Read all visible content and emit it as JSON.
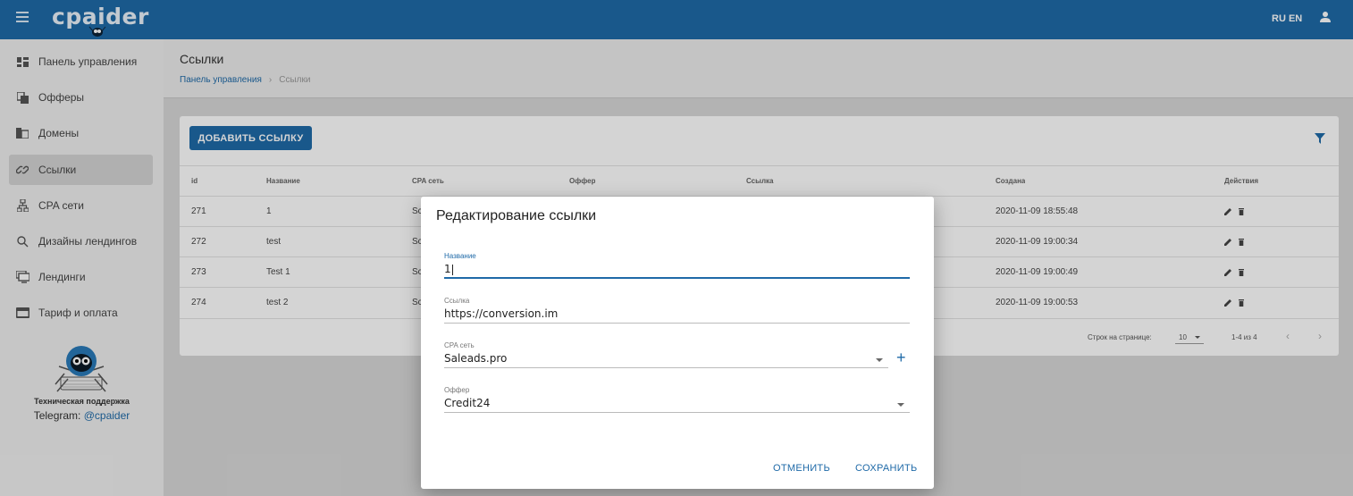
{
  "header": {
    "logo": "cpaider",
    "lang": "RU EN",
    "icons": {
      "menu": "menu-icon",
      "user": "user-icon"
    },
    "accent_color": "#1f6aa8"
  },
  "sidebar": {
    "items": [
      {
        "label": "Панель управления",
        "icon": "dashboard-icon"
      },
      {
        "label": "Офферы",
        "icon": "copy-icon"
      },
      {
        "label": "Домены",
        "icon": "domain-icon"
      },
      {
        "label": "Ссылки",
        "icon": "link-icon",
        "active": true
      },
      {
        "label": "CPA сети",
        "icon": "network-icon"
      },
      {
        "label": "Дизайны лендингов",
        "icon": "search-icon"
      },
      {
        "label": "Лендинги",
        "icon": "monitor-icon"
      },
      {
        "label": "Тариф и оплата",
        "icon": "payment-icon"
      }
    ],
    "support_title": "Техническая поддержка",
    "support_tg_prefix": "Telegram: ",
    "support_tg_handle": "@cpaider"
  },
  "page": {
    "title": "Ссылки",
    "breadcrumb_home": "Панель управления",
    "breadcrumb_sep": "›",
    "breadcrumb_current": "Ссылки"
  },
  "table": {
    "add_button": "ДОБАВИТЬ ССЫЛКУ",
    "columns": [
      "id",
      "Название",
      "CPA сеть",
      "Оффер",
      "Ссылка",
      "Создана",
      "Действия"
    ],
    "rows": [
      {
        "id": "271",
        "name": "1",
        "cpa": "Sc",
        "created": "2020-11-09 18:55:48"
      },
      {
        "id": "272",
        "name": "test",
        "cpa": "Sc",
        "created": "2020-11-09 19:00:34"
      },
      {
        "id": "273",
        "name": "Test 1",
        "cpa": "Sc",
        "created": "2020-11-09 19:00:49"
      },
      {
        "id": "274",
        "name": "test 2",
        "cpa": "Sc",
        "created": "2020-11-09 19:00:53"
      }
    ],
    "footer": {
      "rows_per_page_label": "Строк на странице:",
      "rows_per_page": "10",
      "range": "1-4 из 4",
      "prev": "‹",
      "next": "›"
    }
  },
  "dialog": {
    "title": "Редактирование ссылки",
    "fields": {
      "name": {
        "label": "Название",
        "value": "1"
      },
      "link": {
        "label": "Ссылка",
        "value": "https://conversion.im"
      },
      "cpa": {
        "label": "CPA сеть",
        "value": "Saleads.pro"
      },
      "offer": {
        "label": "Оффер",
        "value": "Credit24"
      }
    },
    "plus": "+",
    "cancel": "ОТМЕНИТЬ",
    "save": "СОХРАНИТЬ"
  }
}
